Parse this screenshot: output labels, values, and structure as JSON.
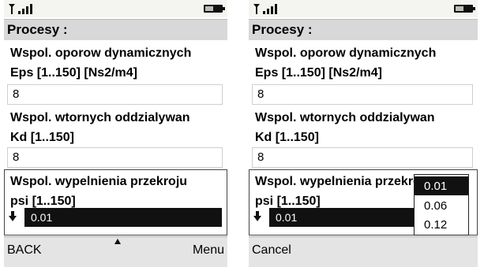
{
  "screens": [
    {
      "title": "Procesy :",
      "fields": [
        {
          "label_line1": "Wspol. oporow dynamicznych",
          "label_line2": "Eps [1..150] [Ns2/m4]",
          "value": "8"
        },
        {
          "label_line1": "Wspol. wtornych oddzialywan",
          "label_line2": "Kd [1..150]",
          "value": "8"
        },
        {
          "label_line1": "Wspol. wypelnienia przekroju",
          "label_line2": "psi [1..150]",
          "value": "0.01"
        }
      ],
      "softkeys": {
        "left": "BACK",
        "right": "Menu"
      }
    },
    {
      "title": "Procesy :",
      "fields": [
        {
          "label_line1": "Wspol. oporow dynamicznych",
          "label_line2": "Eps [1..150] [Ns2/m4]",
          "value": "8"
        },
        {
          "label_line1": "Wspol. wtornych oddzialywan",
          "label_line2": "Kd [1..150]",
          "value": "8"
        },
        {
          "label_line1": "Wspol. wypelnienia przekroju",
          "label_line2": "psi [1..150]",
          "value": "0.01"
        }
      ],
      "popup_options": [
        "0.01",
        "0.06",
        "0.12"
      ],
      "popup_selected": "0.01",
      "softkeys": {
        "left": "Cancel"
      }
    }
  ],
  "icons": {
    "signal": "signal-strength-icon",
    "battery": "battery-icon",
    "choice_indicator": "down-arrow-icon",
    "scroll_indicator": "up-arrow-icon"
  }
}
